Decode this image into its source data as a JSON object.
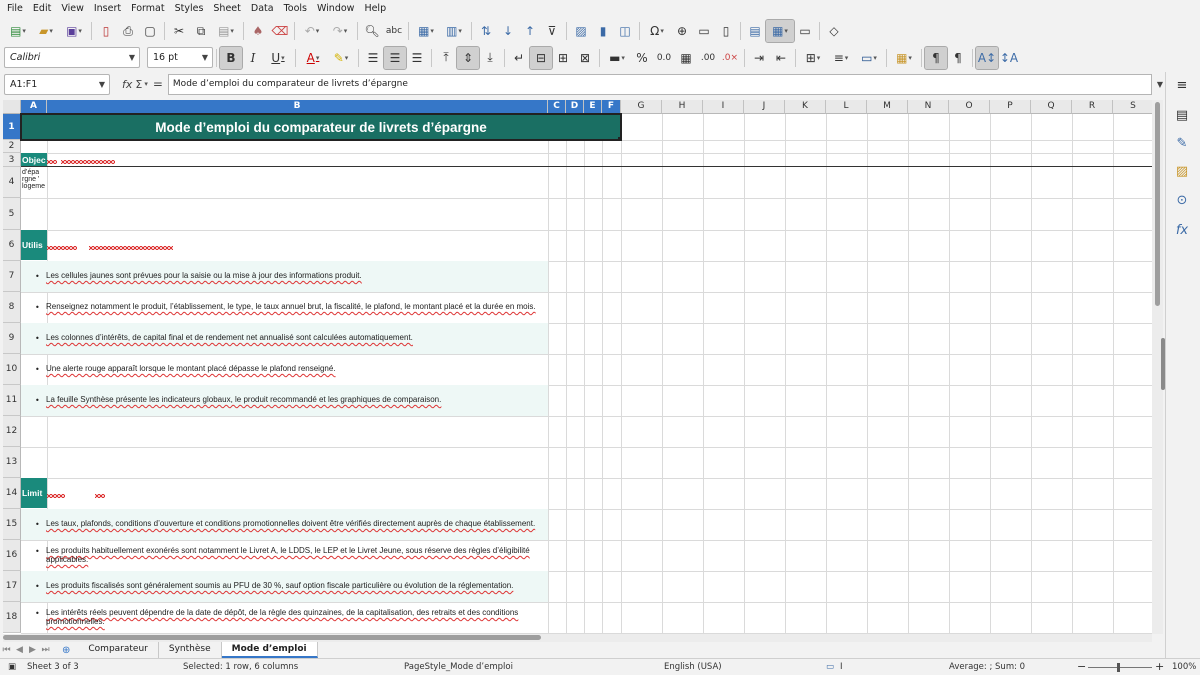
{
  "menu": [
    "File",
    "Edit",
    "View",
    "Insert",
    "Format",
    "Styles",
    "Sheet",
    "Data",
    "Tools",
    "Window",
    "Help"
  ],
  "font": {
    "name": "Calibri",
    "size": "16 pt"
  },
  "namebox": "A1:F1",
  "formula": "Mode d’emploi du comparateur de livrets d’épargne",
  "columns": [
    "A",
    "B",
    "C",
    "D",
    "E",
    "F",
    "G",
    "H",
    "I",
    "J",
    "K",
    "L",
    "M",
    "N",
    "O",
    "P",
    "Q",
    "R",
    "S"
  ],
  "rows": [
    "1",
    "2",
    "3",
    "4",
    "5",
    "6",
    "7",
    "8",
    "9",
    "10",
    "11",
    "12",
    "13",
    "14",
    "15",
    "16",
    "17",
    "18"
  ],
  "cells": {
    "title": "Mode d’emploi du comparateur de livrets d’épargne",
    "objectif": "Objec",
    "objectif_text": "d’épa rgne ' logeme",
    "utilisation": "Utilis",
    "limites": "Limit",
    "bullets_utilisation": [
      "Les cellules jaunes sont prévues pour la saisie ou la mise à jour des informations produit.",
      "Renseignez notamment le produit, l’établissement, le type, le taux annuel brut, la fiscalité, le plafond, le montant placé et la durée en mois.",
      "Les colonnes d’intérêts, de capital final et de rendement net annualisé sont calculées automatiquement.",
      "Une alerte rouge apparaît lorsque le montant placé dépasse le plafond renseigné.",
      "La feuille Synthèse présente les indicateurs globaux, le produit recommandé et les graphiques de comparaison."
    ],
    "bullets_limites": [
      "Les taux, plafonds, conditions d’ouverture et conditions promotionnelles doivent être vérifiés directement auprès de chaque établissement.",
      "Les produits habituellement exonérés sont notamment le Livret A, le LDDS, le LEP et le Livret Jeune, sous réserve des règles d’éligibilité applicables.",
      "Les produits fiscalisés sont généralement soumis au PFU de 30 %, sauf option fiscale particulière ou évolution de la réglementation.",
      "Les intérêts réels peuvent dépendre de la date de dépôt, de la règle des quinzaines, de la capitalisation, des retraits et des conditions promotionnelles."
    ]
  },
  "tabs": [
    "Comparateur",
    "Synthèse",
    "Mode d’emploi"
  ],
  "active_tab": "Mode d’emploi",
  "status": {
    "sheet": "Sheet 3 of 3",
    "selection": "Selected: 1 row, 6 columns",
    "pagestyle": "PageStyle_Mode d’emploi",
    "language": "English (USA)",
    "sum": "Average: ; Sum: 0",
    "zoom": "100%"
  },
  "colors": {
    "title_bg": "#1a6f63",
    "section_bg": "#1a8a7c",
    "bullet_bg": "#eef8f6",
    "selection": "#3677c8"
  }
}
